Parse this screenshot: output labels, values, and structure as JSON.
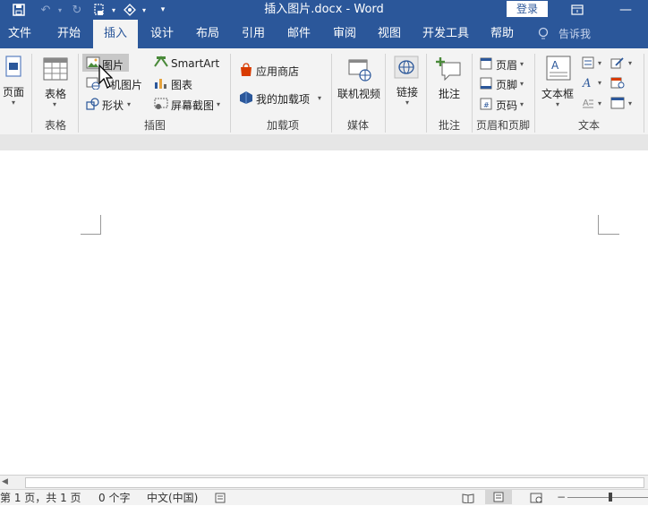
{
  "titlebar": {
    "title": "插入图片.docx - Word",
    "login": "登录"
  },
  "tabs": [
    "文件",
    "开始",
    "插入",
    "设计",
    "布局",
    "引用",
    "邮件",
    "审阅",
    "视图",
    "开发工具",
    "帮助"
  ],
  "active_tab": "插入",
  "tell_me": "告诉我",
  "ribbon": {
    "pages": {
      "label": "页面"
    },
    "tables": {
      "button": "表格",
      "group": "表格"
    },
    "illustrations": {
      "group": "插图",
      "picture": "图片",
      "online_picture": "联机图片",
      "online_picture_visible": "机图片",
      "shapes": "形状",
      "smartart": "SmartArt",
      "chart": "图表",
      "screenshot": "屏幕截图"
    },
    "addins": {
      "group": "加载项",
      "store": "应用商店",
      "my_addins": "我的加载项"
    },
    "media": {
      "group": "媒体",
      "online_video": "联机视频"
    },
    "links": {
      "button": "链接"
    },
    "comments": {
      "group": "批注",
      "button": "批注"
    },
    "header_footer": {
      "group": "页眉和页脚",
      "header": "页眉",
      "footer": "页脚",
      "page_number": "页码"
    },
    "text": {
      "group": "文本",
      "textbox": "文本框"
    }
  },
  "status": {
    "page": "第 1 页，共 1 页",
    "words": "0 个字",
    "language": "中文(中国)"
  },
  "colors": {
    "brand": "#2b579a",
    "ribbon": "#f3f3f3"
  }
}
